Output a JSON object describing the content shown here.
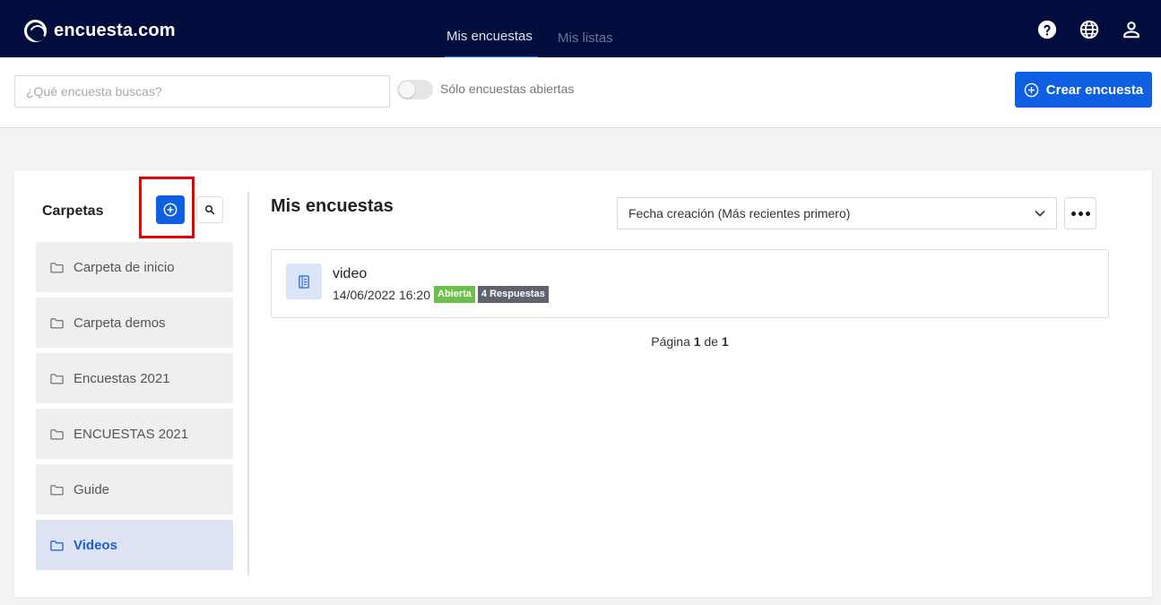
{
  "header": {
    "logo_text": "encuesta.com",
    "tabs": [
      {
        "label": "Mis encuestas",
        "active": true
      },
      {
        "label": "Mis listas",
        "active": false
      }
    ],
    "icons": [
      "help-icon",
      "globe-icon",
      "user-icon"
    ]
  },
  "toolbar": {
    "search_placeholder": "¿Qué encuesta buscas?",
    "toggle_label": "Sólo encuestas abiertas",
    "toggle_on": false,
    "create_label": "Crear encuesta"
  },
  "sidebar": {
    "title": "Carpetas",
    "folders": [
      {
        "label": "Carpeta de inicio",
        "active": false
      },
      {
        "label": "Carpeta demos",
        "active": false
      },
      {
        "label": "Encuestas 2021",
        "active": false
      },
      {
        "label": "ENCUESTAS 2021",
        "active": false
      },
      {
        "label": "Guide",
        "active": false
      },
      {
        "label": "Videos",
        "active": true
      }
    ]
  },
  "main": {
    "title": "Mis encuestas",
    "sort_value": "Fecha creación (Más recientes primero)",
    "surveys": [
      {
        "name": "video",
        "date": "14/06/2022 16:20",
        "status": "Abierta",
        "responses": "4 Respuestas"
      }
    ],
    "pagination": {
      "prefix": "Página",
      "current": "1",
      "separator": "de",
      "total": "1"
    }
  },
  "colors": {
    "header_bg": "#020d3d",
    "primary": "#0e5fe1",
    "open_badge": "#6cc04a",
    "responses_badge": "#5f6370",
    "highlight": "#e00000"
  }
}
